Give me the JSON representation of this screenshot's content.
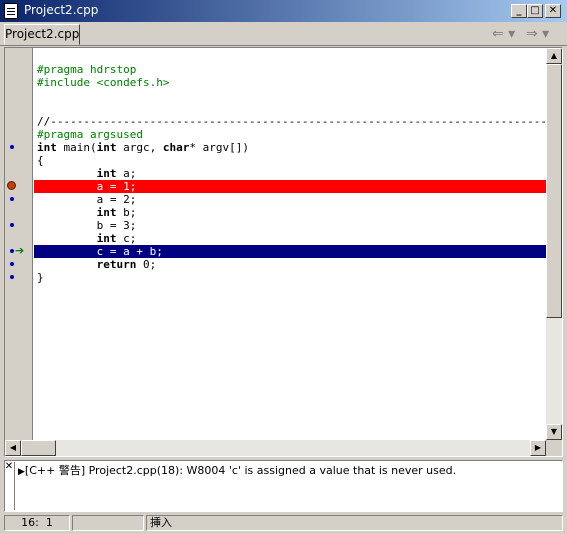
{
  "window": {
    "title": "Project2.cpp",
    "min_label": "_",
    "max_label": "□",
    "close_label": "✕"
  },
  "tabs": [
    {
      "label": "Project2.cpp",
      "active": true
    }
  ],
  "nav": {
    "back": "⇐ ▾",
    "forward": "⇒ ▾"
  },
  "code_lines": [
    {
      "text": "",
      "cls": ""
    },
    {
      "text": "#pragma hdrstop",
      "cls": "pp"
    },
    {
      "text": "#include <condefs.h>",
      "cls": "pp"
    },
    {
      "text": "",
      "cls": ""
    },
    {
      "text": "",
      "cls": ""
    },
    {
      "text": "//---------------------------------------------------------------------------",
      "cls": "cm"
    },
    {
      "text": "#pragma argsused",
      "cls": "pp"
    },
    {
      "text": "int main(int argc, char* argv[])",
      "cls": ""
    },
    {
      "text": "{",
      "cls": ""
    },
    {
      "text": "         int a;",
      "cls": ""
    },
    {
      "text": "         a = 1;",
      "cls": "bp"
    },
    {
      "text": "         a = 2;",
      "cls": ""
    },
    {
      "text": "         int b;",
      "cls": ""
    },
    {
      "text": "         b = 3;",
      "cls": ""
    },
    {
      "text": "         int c;",
      "cls": ""
    },
    {
      "text": "         c = a + b;",
      "cls": "exec"
    },
    {
      "text": "         return 0;",
      "cls": ""
    },
    {
      "text": "}",
      "cls": ""
    }
  ],
  "messages": [
    {
      "text": "[C++ 警告] Project2.cpp(18): W8004 'c' is assigned a value that is never used."
    }
  ],
  "status": {
    "line": "16",
    "col": "1",
    "mode": "挿入"
  },
  "colors": {
    "breakpoint_line": "#ff0000",
    "execution_line": "#000080",
    "preprocessor": "#008000"
  }
}
